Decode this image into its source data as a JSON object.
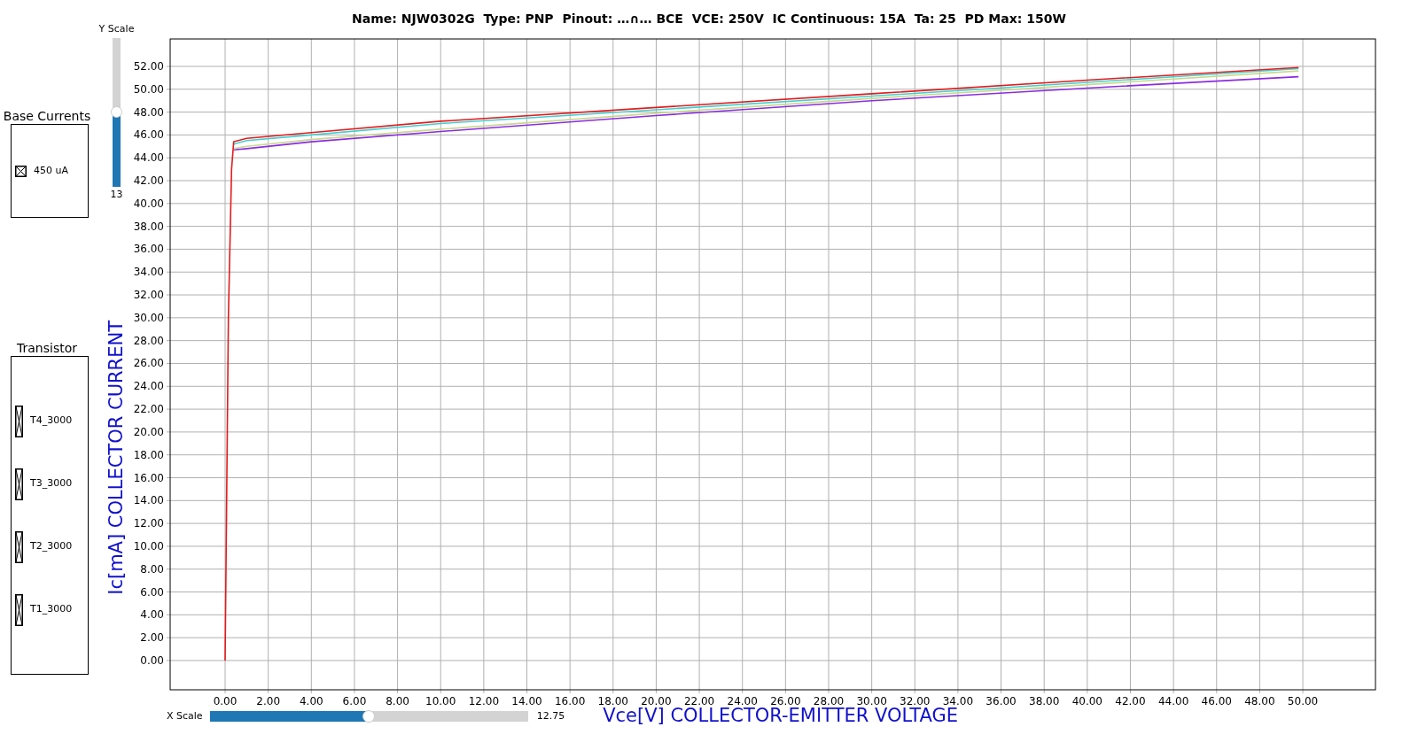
{
  "base_currents": {
    "title": "Base Currents",
    "items": [
      {
        "label": "450 uA",
        "checked": true
      }
    ]
  },
  "transistors": {
    "title": "Transistor",
    "items": [
      {
        "label": "T4_3000",
        "checked": true
      },
      {
        "label": "T3_3000",
        "checked": true
      },
      {
        "label": "T2_3000",
        "checked": true
      },
      {
        "label": "T1_3000",
        "checked": true
      }
    ]
  },
  "y_slider": {
    "label": "Y Scale",
    "value": "13",
    "level": 0.5
  },
  "x_slider": {
    "label": "X Scale",
    "value": "12.75",
    "level": 0.5
  },
  "chart_data": {
    "type": "line",
    "title": "Name: NJW0302G  Type: PNP  Pinout: …∩… BCE  VCE: 250V  IC Continuous: 15A  Ta: 25  PD Max: 150W",
    "xlabel": "Vce[V] COLLECTOR-EMITTER VOLTAGE",
    "ylabel": "Ic[mA] COLLECTOR CURRENT",
    "x": [
      0,
      0.15,
      0.3,
      0.4,
      1,
      4,
      10,
      20,
      30,
      40,
      49.8
    ],
    "series": [
      {
        "color": "#e41a1c",
        "values": [
          0,
          30,
          43,
          45.4,
          45.7,
          46.2,
          47.2,
          48.4,
          49.6,
          50.8,
          51.9
        ]
      },
      {
        "color": "#40d0d0",
        "values": [
          null,
          null,
          null,
          45.2,
          45.5,
          46.0,
          47.0,
          48.2,
          49.4,
          50.6,
          51.8
        ]
      },
      {
        "color": "#c8d890",
        "values": [
          null,
          null,
          null,
          44.8,
          45.0,
          45.6,
          46.5,
          47.9,
          49.2,
          50.4,
          51.6
        ]
      },
      {
        "color": "#8a2be2",
        "values": [
          null,
          null,
          null,
          44.7,
          44.8,
          45.4,
          46.3,
          47.7,
          49.0,
          50.1,
          51.1
        ]
      }
    ],
    "grid": true,
    "xlim": [
      -2.55,
      53.37
    ],
    "ylim": [
      -2.56,
      54.4
    ],
    "xticks": [
      {
        "value": 0,
        "label": "0.00"
      },
      {
        "value": 2,
        "label": "2.00"
      },
      {
        "value": 4,
        "label": "4.00"
      },
      {
        "value": 6,
        "label": "6.00"
      },
      {
        "value": 8,
        "label": "8.00"
      },
      {
        "value": 10,
        "label": "10.00"
      },
      {
        "value": 12,
        "label": "12.00"
      },
      {
        "value": 14,
        "label": "14.00"
      },
      {
        "value": 16,
        "label": "16.00"
      },
      {
        "value": 18,
        "label": "18.00"
      },
      {
        "value": 20,
        "label": "20.00"
      },
      {
        "value": 22,
        "label": "22.00"
      },
      {
        "value": 24,
        "label": "24.00"
      },
      {
        "value": 26,
        "label": "26.00"
      },
      {
        "value": 28,
        "label": "28.00"
      },
      {
        "value": 30,
        "label": "30.00"
      },
      {
        "value": 32,
        "label": "32.00"
      },
      {
        "value": 34,
        "label": "34.00"
      },
      {
        "value": 36,
        "label": "36.00"
      },
      {
        "value": 38,
        "label": "38.00"
      },
      {
        "value": 40,
        "label": "40.00"
      },
      {
        "value": 42,
        "label": "42.00"
      },
      {
        "value": 44,
        "label": "44.00"
      },
      {
        "value": 46,
        "label": "46.00"
      },
      {
        "value": 48,
        "label": "48.00"
      },
      {
        "value": 50,
        "label": "50.00"
      }
    ],
    "yticks": [
      {
        "value": 0,
        "label": "0.00"
      },
      {
        "value": 2,
        "label": "2.00"
      },
      {
        "value": 4,
        "label": "4.00"
      },
      {
        "value": 6,
        "label": "6.00"
      },
      {
        "value": 8,
        "label": "8.00"
      },
      {
        "value": 10,
        "label": "10.00"
      },
      {
        "value": 12,
        "label": "12.00"
      },
      {
        "value": 14,
        "label": "14.00"
      },
      {
        "value": 16,
        "label": "16.00"
      },
      {
        "value": 18,
        "label": "18.00"
      },
      {
        "value": 20,
        "label": "20.00"
      },
      {
        "value": 22,
        "label": "22.00"
      },
      {
        "value": 24,
        "label": "24.00"
      },
      {
        "value": 26,
        "label": "26.00"
      },
      {
        "value": 28,
        "label": "28.00"
      },
      {
        "value": 30,
        "label": "30.00"
      },
      {
        "value": 32,
        "label": "32.00"
      },
      {
        "value": 34,
        "label": "34.00"
      },
      {
        "value": 36,
        "label": "36.00"
      },
      {
        "value": 38,
        "label": "38.00"
      },
      {
        "value": 40,
        "label": "40.00"
      },
      {
        "value": 42,
        "label": "42.00"
      },
      {
        "value": 44,
        "label": "44.00"
      },
      {
        "value": 46,
        "label": "46.00"
      },
      {
        "value": 48,
        "label": "48.00"
      },
      {
        "value": 50,
        "label": "50.00"
      },
      {
        "value": 52,
        "label": "52.00"
      }
    ]
  }
}
